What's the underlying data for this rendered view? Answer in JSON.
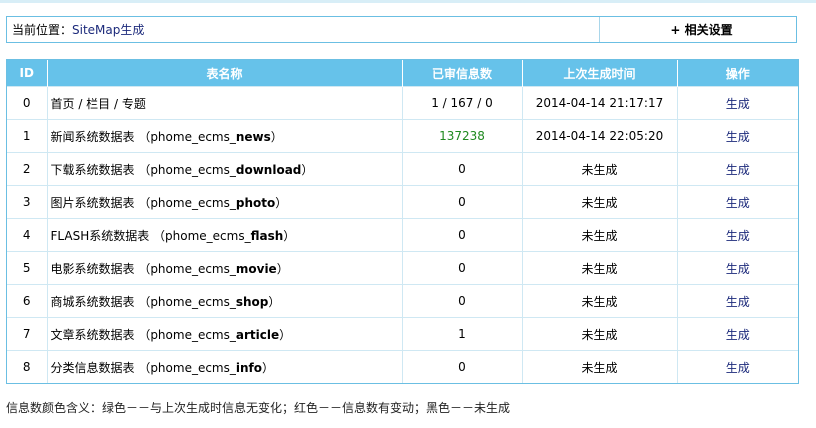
{
  "breadcrumb": {
    "prefix": "当前位置：",
    "current": "SiteMap生成",
    "settings_label": "+ 相关设置"
  },
  "table": {
    "headers": [
      "ID",
      "表名称",
      "已审信息数",
      "上次生成时间",
      "操作"
    ],
    "rows": [
      {
        "id": "0",
        "name": "首页 / 栏目 / 专题",
        "name_pre": "",
        "name_bold": "",
        "name_post": "",
        "count": "1 / 167 / 0",
        "count_color": "black",
        "last_time": "2014-04-14 21:17:17",
        "action": "生成"
      },
      {
        "id": "1",
        "name": "",
        "name_pre": "新闻系统数据表 （phome_ecms_",
        "name_bold": "news",
        "name_post": "）",
        "count": "137238",
        "count_color": "green",
        "last_time": "2014-04-14 22:05:20",
        "action": "生成"
      },
      {
        "id": "2",
        "name": "",
        "name_pre": "下载系统数据表 （phome_ecms_",
        "name_bold": "download",
        "name_post": "）",
        "count": "0",
        "count_color": "black",
        "last_time": "未生成",
        "action": "生成"
      },
      {
        "id": "3",
        "name": "",
        "name_pre": "图片系统数据表 （phome_ecms_",
        "name_bold": "photo",
        "name_post": "）",
        "count": "0",
        "count_color": "black",
        "last_time": "未生成",
        "action": "生成"
      },
      {
        "id": "4",
        "name": "",
        "name_pre": "FLASH系统数据表 （phome_ecms_",
        "name_bold": "flash",
        "name_post": "）",
        "count": "0",
        "count_color": "black",
        "last_time": "未生成",
        "action": "生成"
      },
      {
        "id": "5",
        "name": "",
        "name_pre": "电影系统数据表 （phome_ecms_",
        "name_bold": "movie",
        "name_post": "）",
        "count": "0",
        "count_color": "black",
        "last_time": "未生成",
        "action": "生成"
      },
      {
        "id": "6",
        "name": "",
        "name_pre": "商城系统数据表 （phome_ecms_",
        "name_bold": "shop",
        "name_post": "）",
        "count": "0",
        "count_color": "black",
        "last_time": "未生成",
        "action": "生成"
      },
      {
        "id": "7",
        "name": "",
        "name_pre": "文章系统数据表 （phome_ecms_",
        "name_bold": "article",
        "name_post": "）",
        "count": "1",
        "count_color": "black",
        "last_time": "未生成",
        "action": "生成"
      },
      {
        "id": "8",
        "name": "",
        "name_pre": "分类信息数据表 （phome_ecms_",
        "name_bold": "info",
        "name_post": "）",
        "count": "0",
        "count_color": "black",
        "last_time": "未生成",
        "action": "生成"
      }
    ]
  },
  "legend_text": "信息数颜色含义：绿色－－与上次生成时信息无变化；红色－－信息数有变动；黑色－－未生成",
  "colors": {
    "header_bg": "#66c2ea",
    "border": "#6bbfe3",
    "link": "#1c2a7b",
    "green": "#1f8a1f"
  }
}
